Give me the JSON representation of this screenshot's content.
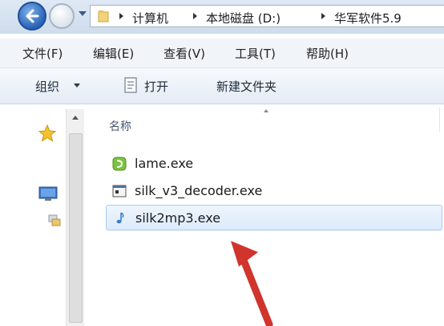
{
  "address_bar": {
    "breadcrumbs": [
      "计算机",
      "本地磁盘 (D:)",
      "华军软件5.9"
    ]
  },
  "menu": {
    "items": [
      "文件(F)",
      "编辑(E)",
      "查看(V)",
      "工具(T)",
      "帮助(H)"
    ]
  },
  "toolbar": {
    "organize_label": "组织",
    "open_label": "打开",
    "new_folder_label": "新建文件夹"
  },
  "file_list": {
    "column_name": "名称",
    "files": [
      {
        "name": "lame.exe",
        "icon": "lame-app-icon",
        "selected": false
      },
      {
        "name": "silk_v3_decoder.exe",
        "icon": "console-app-icon",
        "selected": false
      },
      {
        "name": "silk2mp3.exe",
        "icon": "music-note-icon",
        "selected": true
      }
    ]
  },
  "colors": {
    "selection": "#dcebfc",
    "selection_border": "#a9cbef",
    "annotation_arrow": "#d0342c",
    "back_button": "#2a63b6"
  }
}
